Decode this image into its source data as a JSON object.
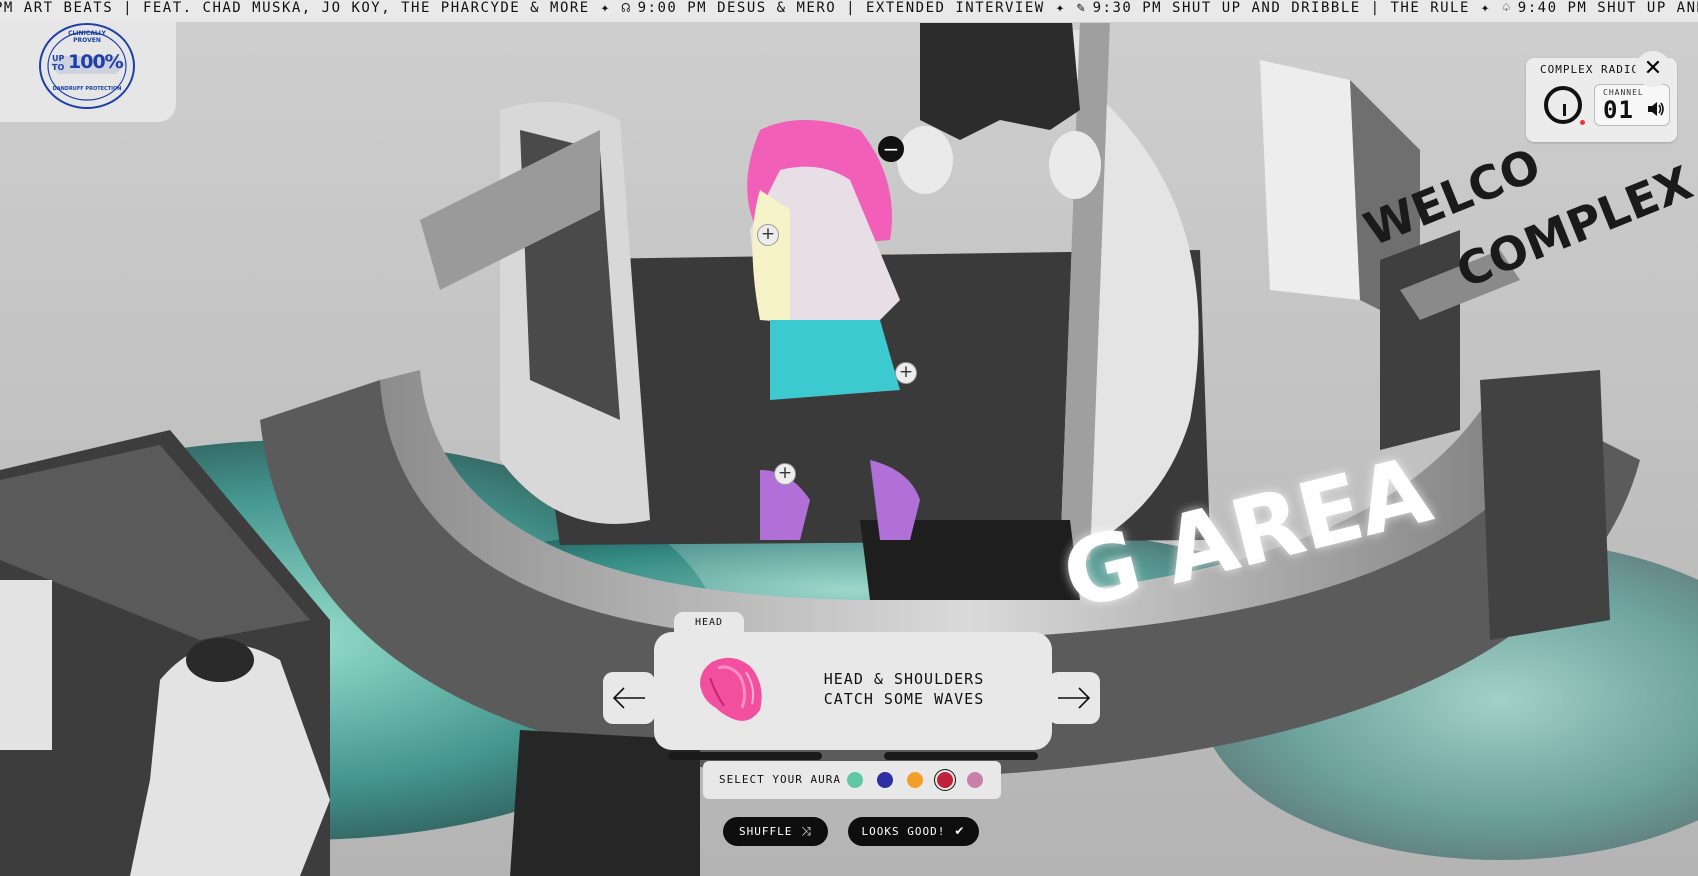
{
  "ticker": {
    "segments": [
      {
        "glyph": "",
        "time": "PM",
        "text": "ART BEATS | FEAT. CHAD MUSKA, JO KOY, THE PHARCYDE & MORE"
      },
      {
        "glyph": "☊",
        "time": "9:00 PM",
        "text": "DESUS & MERO | EXTENDED INTERVIEW"
      },
      {
        "glyph": "✎",
        "time": "9:30 PM",
        "text": "SHUT UP AND DRIBBLE | THE RULE"
      },
      {
        "glyph": "♤",
        "time": "9:40 PM",
        "text": "SHUT UP AND DRIBBLE | THE R"
      }
    ],
    "separator": "✦"
  },
  "sponsor": {
    "badge_text_top": "CLINICALLY PROVEN",
    "badge_up": "UP",
    "badge_to": "TO",
    "badge_value": "100%",
    "badge_text_bottom": "DANDRUFF PROTECTION",
    "accent_color": "#1e3fa8"
  },
  "radio": {
    "title": "COMPLEX RADIO",
    "channel_label": "CHANNEL",
    "channel_number": "01",
    "close_icon": "✕"
  },
  "scene": {
    "sign_text": "G AREA",
    "welcome_text": "WELCO",
    "complex_text": "COMPLEX"
  },
  "hotspots": {
    "add_symbol": "+",
    "remove_symbol": "−"
  },
  "picker": {
    "category": "HEAD",
    "item_name_line1": "HEAD & SHOULDERS",
    "item_name_line2": "CATCH SOME WAVES",
    "prev_icon": "arrow-left-icon",
    "next_icon": "arrow-right-icon"
  },
  "aura": {
    "label": "SELECT YOUR AURA",
    "swatches": [
      "#5fc9a6",
      "#2d2fa3",
      "#f3a02a",
      "#c0203a",
      "#c97fa7"
    ],
    "selected_index": 3
  },
  "actions": {
    "shuffle_label": "SHUFFLE",
    "shuffle_icon": "⤨",
    "confirm_label": "LOOKS GOOD!",
    "confirm_icon": "✔"
  }
}
